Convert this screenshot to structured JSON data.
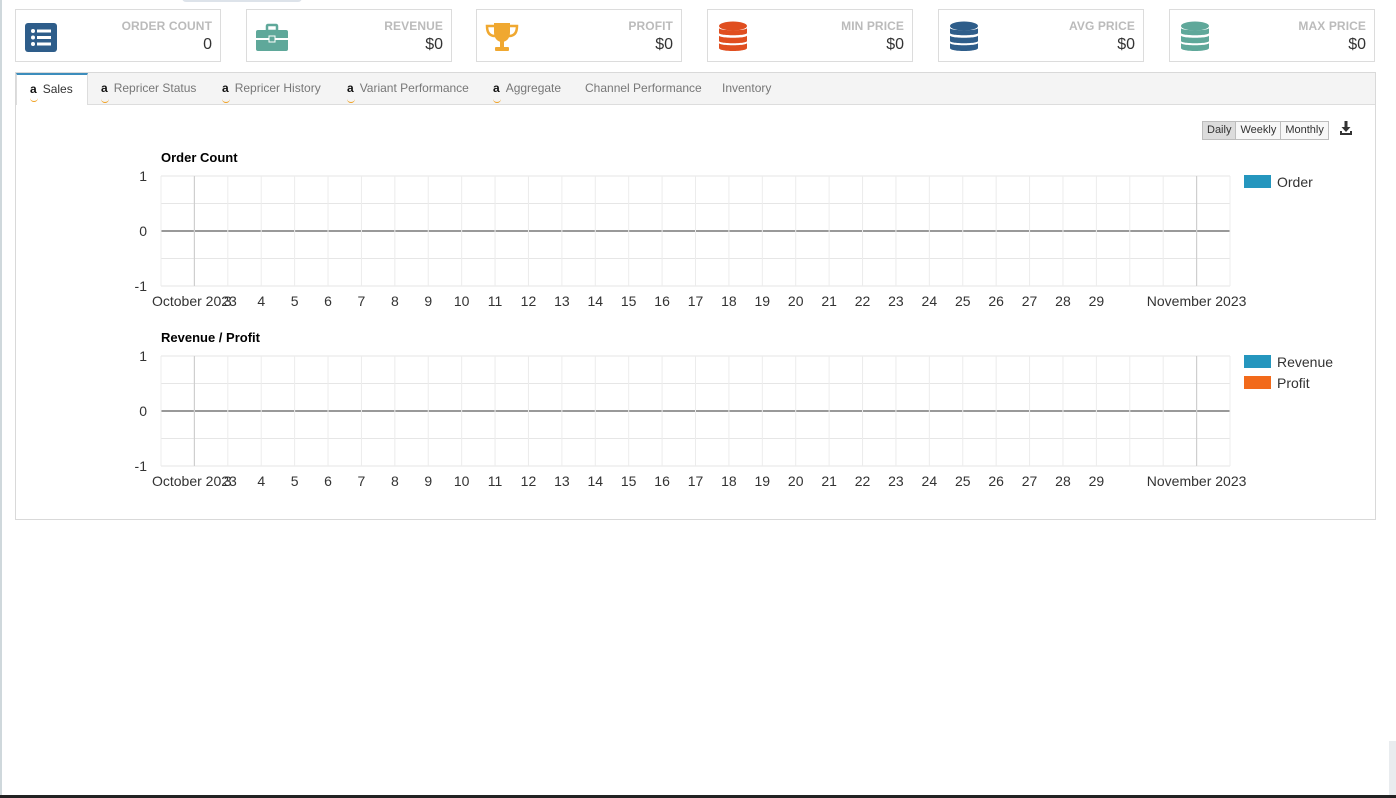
{
  "stats": [
    {
      "label": "ORDER COUNT",
      "value": "0",
      "icon": "list-icon",
      "color": "#2e5d8a"
    },
    {
      "label": "REVENUE",
      "value": "$0",
      "icon": "briefcase-icon",
      "color": "#5fa89a"
    },
    {
      "label": "PROFIT",
      "value": "$0",
      "icon": "trophy-icon",
      "color": "#f0a830"
    },
    {
      "label": "MIN PRICE",
      "value": "$0",
      "icon": "database-icon",
      "color": "#e04e1f"
    },
    {
      "label": "AVG PRICE",
      "value": "$0",
      "icon": "database-icon",
      "color": "#2e5d8a"
    },
    {
      "label": "MAX PRICE",
      "value": "$0",
      "icon": "database-icon",
      "color": "#5fa89a"
    }
  ],
  "tabs": [
    {
      "label": "Sales",
      "amazon": true,
      "active": true
    },
    {
      "label": "Repricer Status",
      "amazon": true
    },
    {
      "label": "Repricer History",
      "amazon": true
    },
    {
      "label": "Variant Performance",
      "amazon": true
    },
    {
      "label": "Aggregate",
      "amazon": true
    },
    {
      "label": "Channel Performance",
      "amazon": false
    },
    {
      "label": "Inventory",
      "amazon": false
    }
  ],
  "amazon_mark": "a",
  "range_buttons": [
    "Daily",
    "Weekly",
    "Monthly"
  ],
  "active_range": "Daily",
  "download_icon": "download-icon",
  "chart_data": [
    {
      "type": "line",
      "title": "Order Count",
      "x_tick_labels": [
        "October 2023",
        "3",
        "4",
        "5",
        "6",
        "7",
        "8",
        "9",
        "10",
        "11",
        "12",
        "13",
        "14",
        "15",
        "16",
        "17",
        "18",
        "19",
        "20",
        "21",
        "22",
        "23",
        "24",
        "25",
        "26",
        "27",
        "28",
        "29",
        "November 2023"
      ],
      "x_range": [
        "2023-10-02",
        "2023-11-03"
      ],
      "ylim": [
        -1,
        1
      ],
      "y_ticks": [
        1,
        0,
        -1
      ],
      "grid": true,
      "legend_position": "right",
      "series": [
        {
          "name": "Order",
          "color": "#2596be",
          "values": []
        }
      ]
    },
    {
      "type": "line",
      "title": "Revenue / Profit",
      "x_tick_labels": [
        "October 2023",
        "3",
        "4",
        "5",
        "6",
        "7",
        "8",
        "9",
        "10",
        "11",
        "12",
        "13",
        "14",
        "15",
        "16",
        "17",
        "18",
        "19",
        "20",
        "21",
        "22",
        "23",
        "24",
        "25",
        "26",
        "27",
        "28",
        "29",
        "November 2023"
      ],
      "x_range": [
        "2023-10-02",
        "2023-11-03"
      ],
      "ylim": [
        -1,
        1
      ],
      "y_ticks": [
        1,
        0,
        -1
      ],
      "grid": true,
      "legend_position": "right",
      "series": [
        {
          "name": "Revenue",
          "color": "#2596be",
          "values": []
        },
        {
          "name": "Profit",
          "color": "#f26a1b",
          "values": []
        }
      ]
    }
  ]
}
